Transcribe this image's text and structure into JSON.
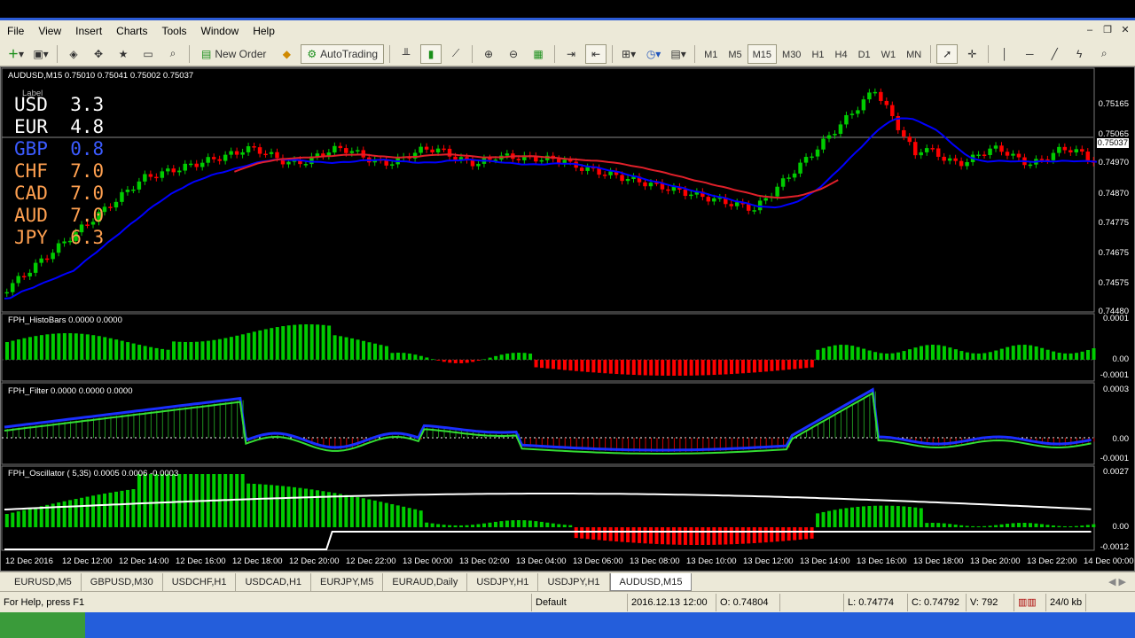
{
  "menu": {
    "items": [
      "File",
      "View",
      "Insert",
      "Charts",
      "Tools",
      "Window",
      "Help"
    ]
  },
  "toolbar": {
    "new_order": "New Order",
    "autotrading": "AutoTrading",
    "timeframes": [
      "M1",
      "M5",
      "M15",
      "M30",
      "H1",
      "H4",
      "D1",
      "W1",
      "MN"
    ],
    "active_timeframe": "M15"
  },
  "chart": {
    "main_title": "AUDUSD,M15  0.75010 0.75041 0.75002 0.75037",
    "label_text": "Label",
    "price_labels": [
      "0.75165",
      "0.75065",
      "0.75037",
      "0.74970",
      "0.74870",
      "0.74775",
      "0.74675",
      "0.74575",
      "0.74480"
    ],
    "currencies": [
      {
        "name": "USD",
        "value": "3.3",
        "color": "#ffffff"
      },
      {
        "name": "EUR",
        "value": "4.8",
        "color": "#ffffff"
      },
      {
        "name": "GBP",
        "value": "0.8",
        "color": "#3b5bff"
      },
      {
        "name": "CHF",
        "value": "7.0",
        "color": "#ffa050"
      },
      {
        "name": "CAD",
        "value": "7.0",
        "color": "#ffa050"
      },
      {
        "name": "AUD",
        "value": "7.0",
        "color": "#ffa050"
      },
      {
        "name": "JPY",
        "value": "6.3",
        "color": "#ffa050"
      }
    ],
    "panel1": {
      "title": "FPH_HistoBars 0.0000 0.0000",
      "labels": [
        "0.0001",
        "0.00",
        "-0.0001"
      ]
    },
    "panel2": {
      "title": "FPH_Filter 0.0000 0.0000 0.0000",
      "labels": [
        "0.0003",
        "0.00",
        "-0.0001"
      ]
    },
    "panel3": {
      "title": "FPH_Oscillator ( 5,35) 0.0005 0.0006 -0.0003",
      "labels": [
        "0.0027",
        "0.00",
        "-0.0012"
      ]
    },
    "time_labels": [
      "12 Dec 2016",
      "12 Dec 12:00",
      "12 Dec 14:00",
      "12 Dec 16:00",
      "12 Dec 18:00",
      "12 Dec 20:00",
      "12 Dec 22:00",
      "13 Dec 00:00",
      "13 Dec 02:00",
      "13 Dec 04:00",
      "13 Dec 06:00",
      "13 Dec 08:00",
      "13 Dec 10:00",
      "13 Dec 12:00",
      "13 Dec 14:00",
      "13 Dec 16:00",
      "13 Dec 18:00",
      "13 Dec 20:00",
      "13 Dec 22:00",
      "14 Dec 00:00"
    ]
  },
  "tabs": {
    "items": [
      "EURUSD,M5",
      "GBPUSD,M30",
      "USDCHF,H1",
      "USDCAD,H1",
      "EURJPY,M5",
      "EURAUD,Daily",
      "USDJPY,H1",
      "USDJPY,H1",
      "AUDUSD,M15"
    ],
    "active": "AUDUSD,M15"
  },
  "status": {
    "help": "For Help, press F1",
    "profile": "Default",
    "datetime": "2016.12.13 12:00",
    "open": "O: 0.74804",
    "low": "L: 0.74774",
    "close": "C: 0.74792",
    "volume": "V: 792",
    "traffic": "24/0 kb"
  },
  "colors": {
    "bull": "#00cc00",
    "bear": "#ff0000",
    "ma_slow": "#0000ff",
    "ma_fast": "#e0202a",
    "grid": "#ffffff"
  }
}
